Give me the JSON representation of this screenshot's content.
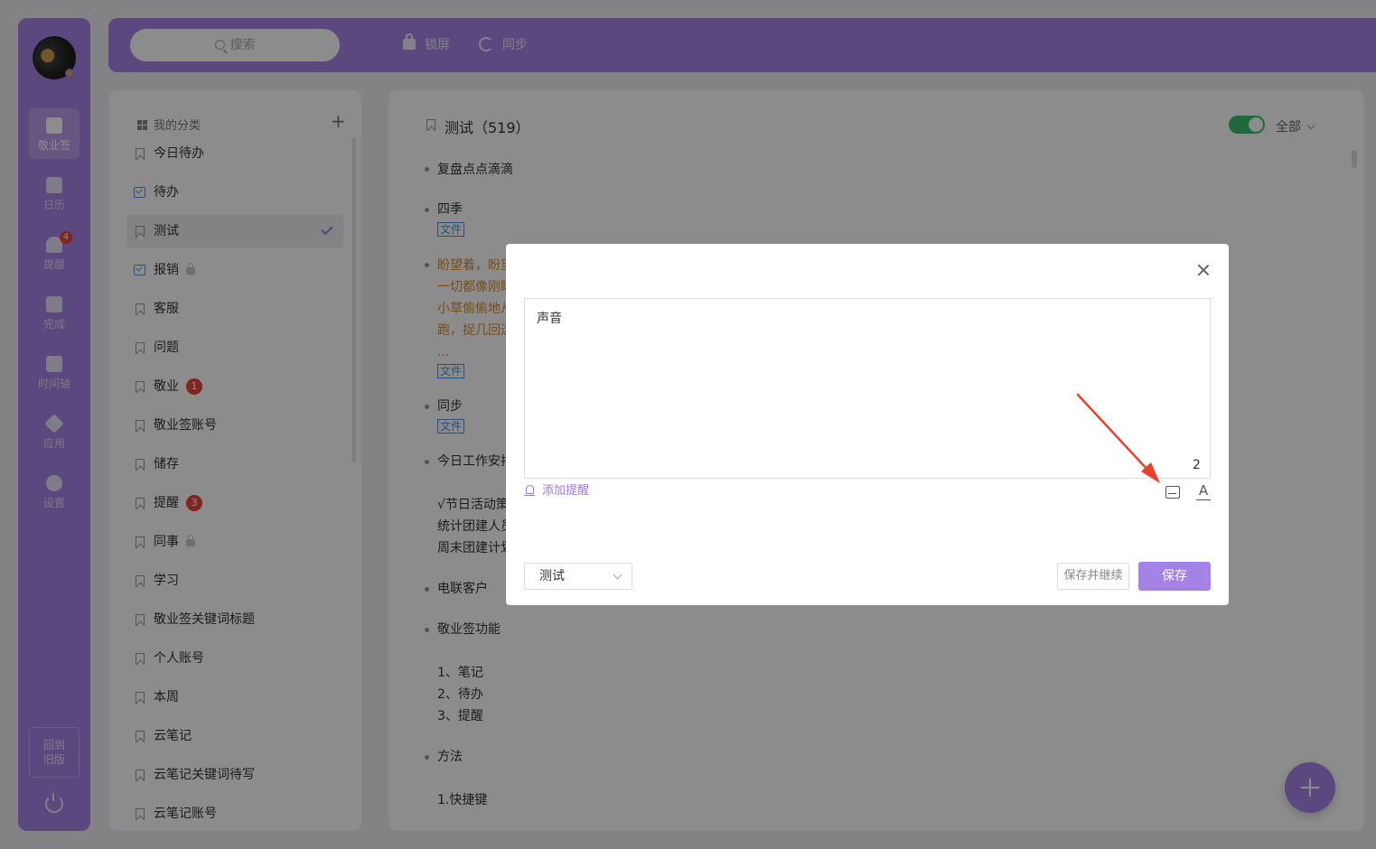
{
  "colors": {
    "accent": "#a583e6",
    "badge_red": "#e8453c",
    "toggle_green": "#3bbf6a",
    "tag_blue": "#4b92e0",
    "note_orange": "#d88a26",
    "annotation_arrow": "#e8412c"
  },
  "rail": {
    "items": [
      {
        "label": "敬业签",
        "icon": "cloud-note-icon"
      },
      {
        "label": "日历",
        "icon": "calendar-icon"
      },
      {
        "label": "提醒",
        "icon": "bell-icon",
        "badge": "4"
      },
      {
        "label": "完成",
        "icon": "clipboard-check-icon"
      },
      {
        "label": "时间轴",
        "icon": "timeline-icon"
      },
      {
        "label": "应用",
        "icon": "cube-icon"
      },
      {
        "label": "设置",
        "icon": "gear-icon"
      }
    ],
    "old_version": "回到旧版"
  },
  "topbar": {
    "search_placeholder": "搜索",
    "lock_label": "锁屏",
    "sync_label": "同步"
  },
  "categories": {
    "header": "我的分类",
    "items": [
      {
        "label": "今日待办"
      },
      {
        "label": "待办"
      },
      {
        "label": "测试"
      },
      {
        "label": "报销"
      },
      {
        "label": "客服"
      },
      {
        "label": "问题"
      },
      {
        "label": "敬业",
        "badge": "1"
      },
      {
        "label": "敬业签账号"
      },
      {
        "label": "储存"
      },
      {
        "label": "提醒",
        "badge": "3"
      },
      {
        "label": "同事"
      },
      {
        "label": "学习"
      },
      {
        "label": "敬业签关键词标题"
      },
      {
        "label": "个人账号"
      },
      {
        "label": "本周"
      },
      {
        "label": "云笔记"
      },
      {
        "label": "云笔记关键词待写"
      },
      {
        "label": "云笔记账号"
      }
    ]
  },
  "notes": {
    "title": "测试（519）",
    "filter": "全部",
    "lines": [
      "复盘点点滴滴",
      "四季",
      "文件",
      "盼望着，盼望",
      "一切都像刚睡",
      "小草偷偷地从",
      "跑，捉几回迷",
      "...",
      "文件",
      "同步",
      "文件",
      "今日工作安排",
      "√节日活动策",
      "统计团建人员",
      "周末团建计划",
      "电联客户",
      "敬业签功能",
      "1、笔记",
      "2、待办",
      "3、提醒",
      "方法",
      "1.快捷键"
    ]
  },
  "dialog": {
    "editor_text": "声音",
    "char_count": "2",
    "add_reminder": "添加提醒",
    "category_select": "测试",
    "save_continue": "保存并继续",
    "save": "保存"
  }
}
